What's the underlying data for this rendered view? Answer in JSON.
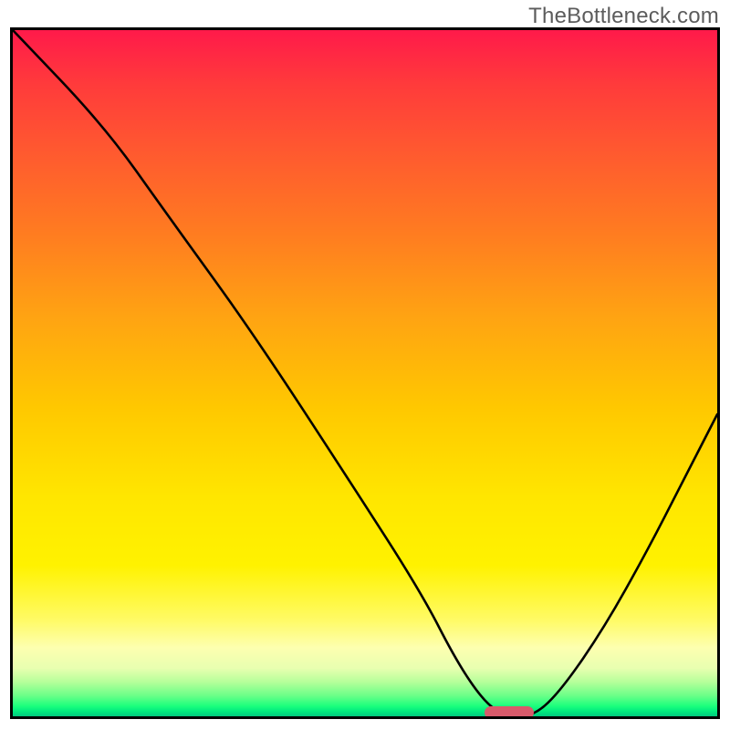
{
  "watermark": "TheBottleneck.com",
  "chart_data": {
    "type": "line",
    "title": "",
    "xlabel": "",
    "ylabel": "",
    "xlim": [
      0,
      100
    ],
    "ylim": [
      0,
      100
    ],
    "series": [
      {
        "name": "curve",
        "x": [
          0,
          13,
          22,
          34,
          48,
          58,
          63,
          67,
          70,
          74,
          78,
          84,
          90,
          95,
          100
        ],
        "values": [
          100,
          86,
          73,
          56,
          34,
          18,
          8,
          2,
          0,
          0,
          4,
          13,
          24,
          34,
          44
        ]
      }
    ],
    "marker": {
      "x_start": 67,
      "x_end": 74,
      "y": 0
    },
    "colors": {
      "curve_stroke": "#000000",
      "marker_fill": "#d85a6b",
      "frame_border": "#000000",
      "gradient_top": "#ff1a4a",
      "gradient_mid": "#ffe600",
      "gradient_bottom": "#00c97e"
    }
  }
}
